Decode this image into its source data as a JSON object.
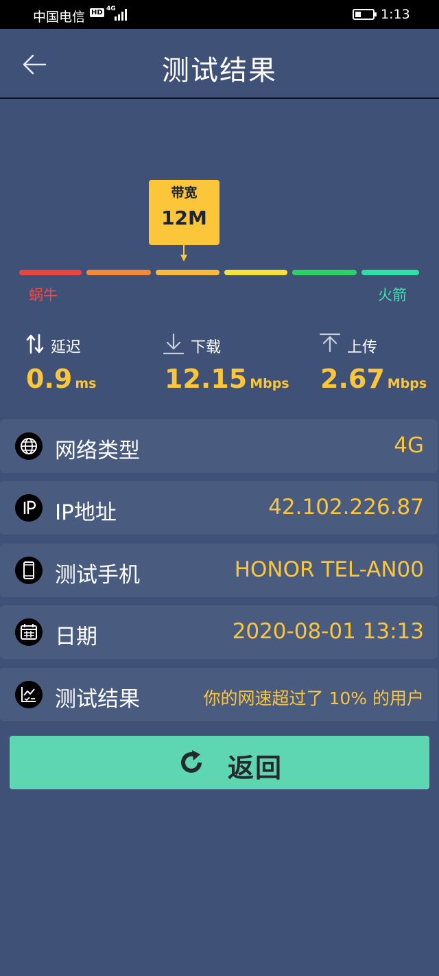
{
  "status_bar": {
    "carrier": "中国电信",
    "hd": "HD",
    "network": "4G",
    "time": "1:13"
  },
  "header": {
    "title": "测试结果",
    "back_icon": "arrow-left-icon"
  },
  "gauge": {
    "badge_label": "带宽",
    "badge_value": "12M",
    "left_label": "蜗牛",
    "right_label": "火箭",
    "segment_colors": [
      "#e8463f",
      "#f28a3a",
      "#f9b93d",
      "#f4e33a",
      "#2fd066",
      "#2fe0a6"
    ],
    "left_color": "#ee4a4a",
    "right_color": "#3fe3b0"
  },
  "metrics": {
    "latency": {
      "label": "延迟",
      "value": "0.9",
      "unit": "ms",
      "icon": "up-down-arrows-icon"
    },
    "download": {
      "label": "下载",
      "value": "12.15",
      "unit": "Mbps",
      "icon": "download-icon"
    },
    "upload": {
      "label": "上传",
      "value": "2.67",
      "unit": "Mbps",
      "icon": "upload-icon"
    }
  },
  "info_rows": {
    "network_type": {
      "label": "网络类型",
      "value": "4G",
      "icon": "globe-icon"
    },
    "ip": {
      "label": "IP地址",
      "value": "42.102.226.87",
      "icon": "ip-icon"
    },
    "phone": {
      "label": "测试手机",
      "value": "HONOR TEL-AN00",
      "icon": "phone-icon"
    },
    "date": {
      "label": "日期",
      "value": "2020-08-01 13:13",
      "icon": "calendar-icon"
    },
    "result": {
      "label": "测试结果",
      "value": "你的网速超过了 10% 的用户",
      "icon": "chart-check-icon"
    }
  },
  "actions": {
    "return_label": "返回",
    "return_icon": "refresh-icon"
  },
  "colors": {
    "background": "#3f5177",
    "row_background": "#4a5b80",
    "accent": "#fcc63b",
    "button": "#5fd6b2"
  }
}
